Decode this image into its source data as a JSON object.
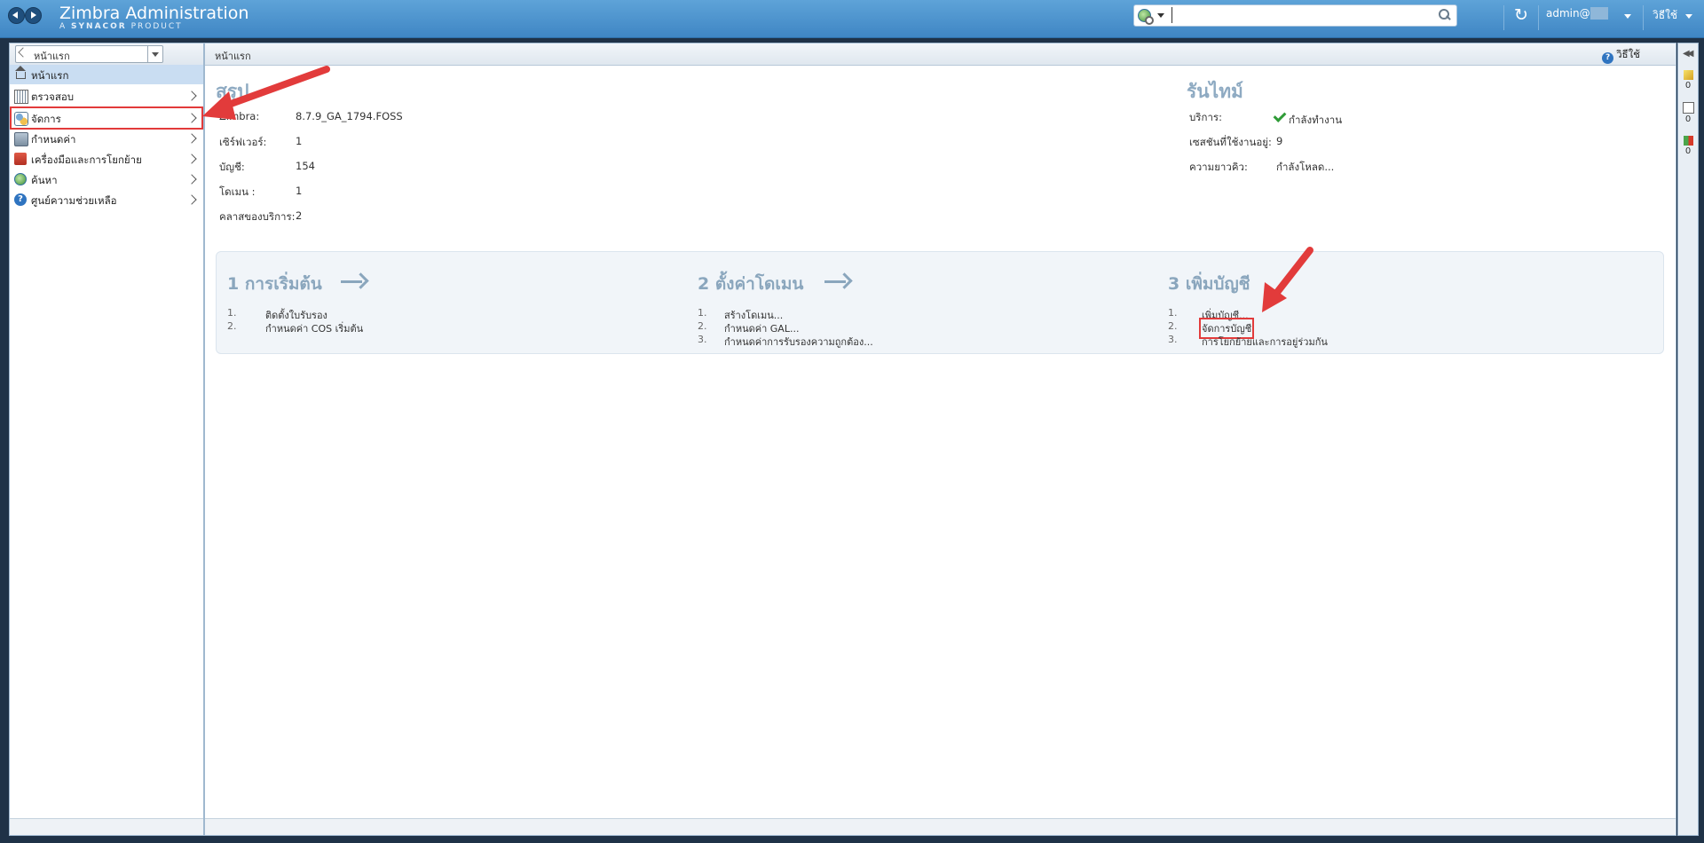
{
  "header": {
    "app_title": "Zimbra Administration",
    "app_subtitle_prefix": "A",
    "app_subtitle_brand": "SYNACOR",
    "app_subtitle_suffix": "PRODUCT",
    "search_placeholder": "",
    "user_name": "admin@",
    "help_label": "วิธีใช้"
  },
  "tree": {
    "dropdown_label": "หน้าแรก",
    "items": [
      {
        "label": "หน้าแรก"
      },
      {
        "label": "ตรวจสอบ"
      },
      {
        "label": "จัดการ"
      },
      {
        "label": "กำหนดค่า"
      },
      {
        "label": "เครื่องมือและการโยกย้าย"
      },
      {
        "label": "ค้นหา"
      },
      {
        "label": "ศูนย์ความช่วยเหลือ"
      }
    ]
  },
  "main": {
    "breadcrumb": "หน้าแรก",
    "help_label": "วิธีใช้",
    "summary": {
      "title": "สรุป",
      "rows": [
        {
          "label": "Zimbra:",
          "value": "8.7.9_GA_1794.FOSS"
        },
        {
          "label": "เซิร์ฟเวอร์:",
          "value": "1"
        },
        {
          "label": "บัญชี:",
          "value": "154"
        },
        {
          "label": "โดเมน :",
          "value": "1"
        },
        {
          "label": "คลาสของบริการ:",
          "value": "2"
        }
      ]
    },
    "runtime": {
      "title": "รันไทม์",
      "rows": [
        {
          "label": "บริการ:",
          "value": "กำลังทำงาน"
        },
        {
          "label": "เซสชันที่ใช้งานอยู่:",
          "value": "9"
        },
        {
          "label": "ความยาวคิว:",
          "value": "กำลังโหลด..."
        }
      ]
    },
    "steps": [
      {
        "title": "1 การเริ่มต้น",
        "items": [
          {
            "num": "1.",
            "label": "ติดตั้งใบรับรอง"
          },
          {
            "num": "2.",
            "label": "กำหนดค่า COS เริ่มต้น"
          }
        ]
      },
      {
        "title": "2 ตั้งค่าโดเมน",
        "items": [
          {
            "num": "1.",
            "label": "สร้างโดเมน..."
          },
          {
            "num": "2.",
            "label": "กำหนดค่า GAL..."
          },
          {
            "num": "3.",
            "label": "กำหนดค่าการรับรองความถูกต้อง..."
          }
        ]
      },
      {
        "title": "3 เพิ่มบัญชี",
        "items": [
          {
            "num": "1.",
            "label": "เพิ่มบัญชี..."
          },
          {
            "num": "2.",
            "label": "จัดการบัญชี"
          },
          {
            "num": "3.",
            "label": "การโยกย้ายและการอยู่ร่วมกัน"
          }
        ]
      }
    ]
  },
  "right_panel": {
    "counts": [
      "0",
      "0",
      "0"
    ]
  },
  "colors": {
    "header_blue": "#3f86c4",
    "annotation_red": "#e23b3b",
    "section_title": "#8eaac2",
    "status_green": "#2f9b37"
  }
}
